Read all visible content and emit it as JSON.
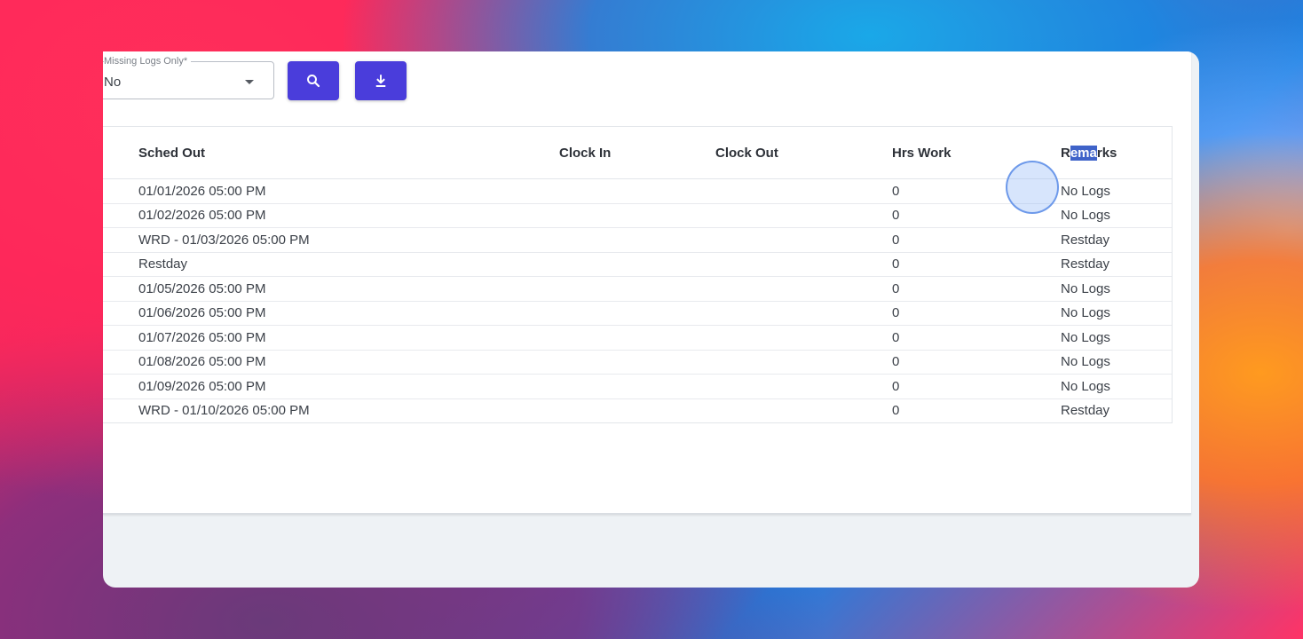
{
  "filter": {
    "label": "Missing Logs Only*",
    "value": "No"
  },
  "buttons": {
    "search_icon": "search-icon",
    "download_icon": "download-icon",
    "accent": "#4a3ddb"
  },
  "table": {
    "headers": {
      "sched_out": "Sched Out",
      "clock_in": "Clock In",
      "clock_out": "Clock Out",
      "hrs_work": "Hrs Work",
      "remarks_pre": "R",
      "remarks_sel": "ema",
      "remarks_post": "rks"
    },
    "rows": [
      {
        "sched_out": "01/01/2026 05:00 PM",
        "clock_in": "",
        "clock_out": "",
        "hrs_work": "0",
        "remarks": "No Logs"
      },
      {
        "sched_out": "01/02/2026 05:00 PM",
        "clock_in": "",
        "clock_out": "",
        "hrs_work": "0",
        "remarks": "No Logs"
      },
      {
        "sched_out": "WRD - 01/03/2026 05:00 PM",
        "clock_in": "",
        "clock_out": "",
        "hrs_work": "0",
        "remarks": "Restday"
      },
      {
        "sched_out": "Restday",
        "clock_in": "",
        "clock_out": "",
        "hrs_work": "0",
        "remarks": "Restday"
      },
      {
        "sched_out": "01/05/2026 05:00 PM",
        "clock_in": "",
        "clock_out": "",
        "hrs_work": "0",
        "remarks": "No Logs"
      },
      {
        "sched_out": "01/06/2026 05:00 PM",
        "clock_in": "",
        "clock_out": "",
        "hrs_work": "0",
        "remarks": "No Logs"
      },
      {
        "sched_out": "01/07/2026 05:00 PM",
        "clock_in": "",
        "clock_out": "",
        "hrs_work": "0",
        "remarks": "No Logs"
      },
      {
        "sched_out": "01/08/2026 05:00 PM",
        "clock_in": "",
        "clock_out": "",
        "hrs_work": "0",
        "remarks": "No Logs"
      },
      {
        "sched_out": "01/09/2026 05:00 PM",
        "clock_in": "",
        "clock_out": "",
        "hrs_work": "0",
        "remarks": "No Logs"
      },
      {
        "sched_out": "WRD - 01/10/2026 05:00 PM",
        "clock_in": "",
        "clock_out": "",
        "hrs_work": "0",
        "remarks": "Restday"
      }
    ]
  }
}
